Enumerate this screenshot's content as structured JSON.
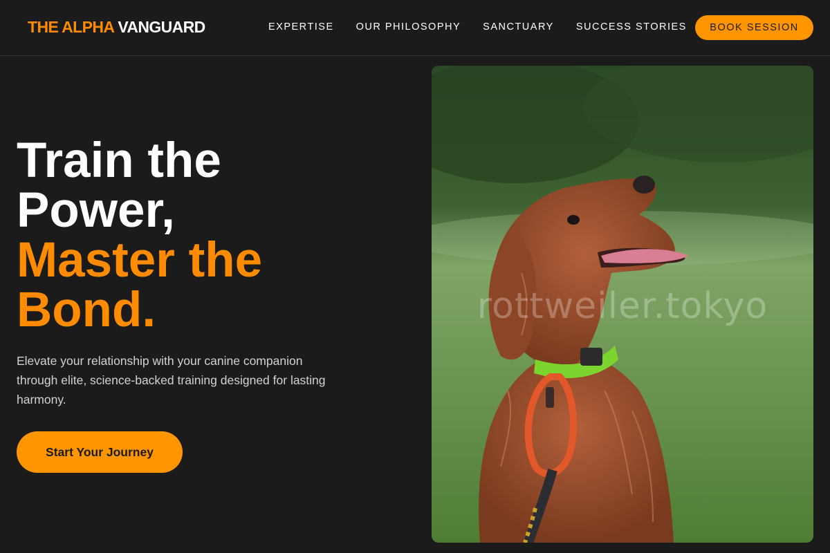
{
  "brand": {
    "accent": "THE ALPHA",
    "plain": "VANGUARD"
  },
  "nav": {
    "links": [
      "EXPERTISE",
      "OUR PHILOSOPHY",
      "SANCTUARY",
      "SUCCESS STORIES"
    ],
    "book_button": "BOOK SESSION"
  },
  "hero": {
    "title_line1": "Train the",
    "title_line2": "Power,",
    "title_line3": "Master the",
    "title_line4": "Bond.",
    "subtitle": "Elevate your relationship with your canine companion through elite, science-backed training designed for lasting harmony.",
    "cta_label": "Start Your Journey"
  },
  "photo": {
    "subject": "red-haired dog with green collar and orange carabiner sitting on grass",
    "watermark": "rottweiler.tokyo"
  },
  "colors": {
    "background": "#1b1b1b",
    "accent": "#ff8c00",
    "button": "#ff9500"
  }
}
